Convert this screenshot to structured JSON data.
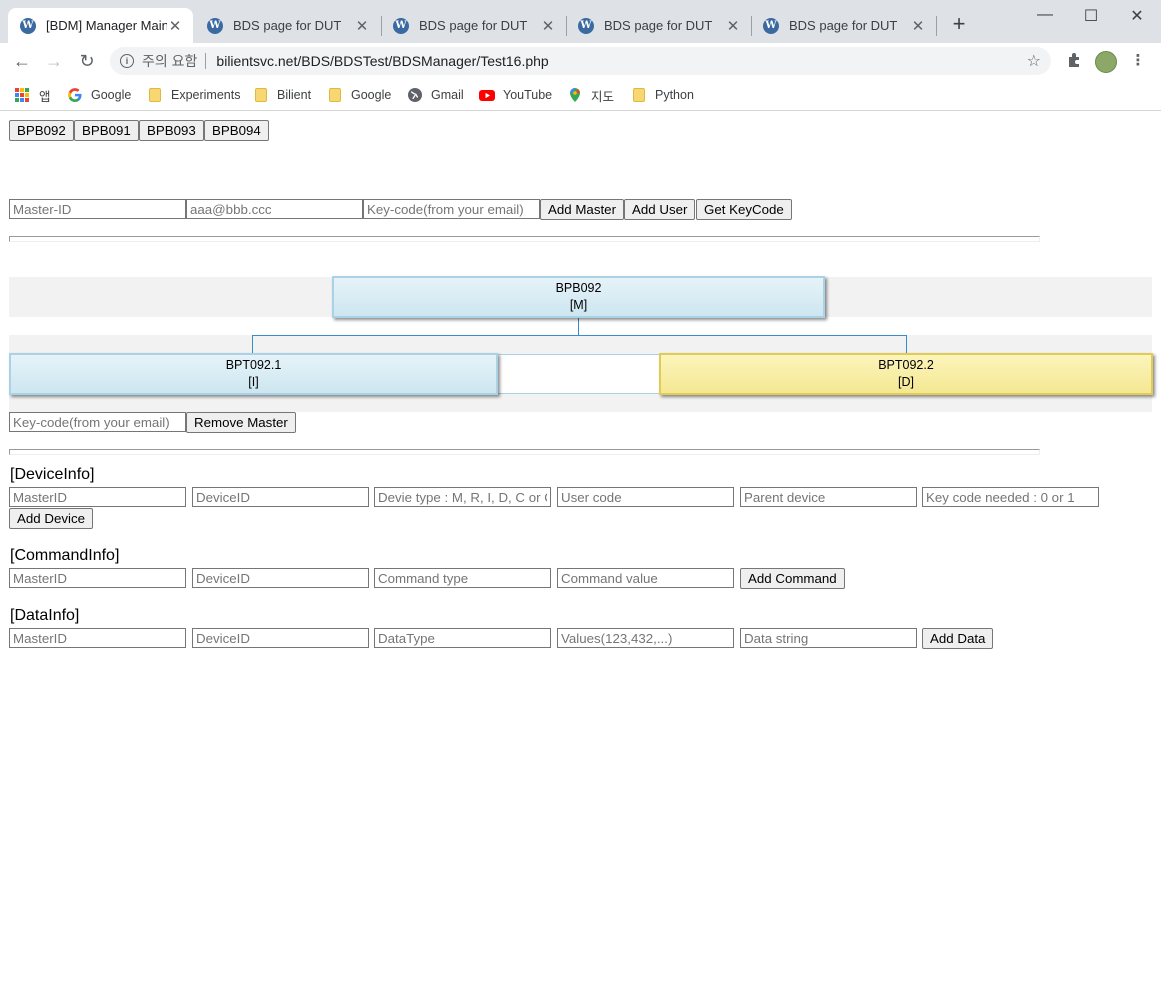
{
  "browser": {
    "tabs": [
      {
        "title": "[BDM] Manager Main",
        "active": true
      },
      {
        "title": "BDS page for DUT",
        "active": false
      },
      {
        "title": "BDS page for DUT",
        "active": false
      },
      {
        "title": "BDS page for DUT",
        "active": false
      },
      {
        "title": "BDS page for DUT",
        "active": false
      }
    ],
    "security_label": "주의 요함",
    "url": "bilientsvc.net/BDS/BDSTest/BDSManager/Test16.php",
    "bookmarks": [
      {
        "label": "앱",
        "icon": "apps-grid-icon"
      },
      {
        "label": "Google",
        "icon": "google-icon"
      },
      {
        "label": "Experiments",
        "icon": "folder-icon"
      },
      {
        "label": "Bilient",
        "icon": "folder-icon"
      },
      {
        "label": "Google",
        "icon": "folder-icon"
      },
      {
        "label": "Gmail",
        "icon": "globe-icon"
      },
      {
        "label": "YouTube",
        "icon": "youtube-icon"
      },
      {
        "label": "지도",
        "icon": "maps-pin-icon"
      },
      {
        "label": "Python",
        "icon": "folder-icon"
      }
    ]
  },
  "device_tabs": [
    "BPB092",
    "BPB091",
    "BPB093",
    "BPB094"
  ],
  "master_form": {
    "master_id_placeholder": "Master-ID",
    "email_placeholder": "aaa@bbb.ccc",
    "keycode_placeholder": "Key-code(from your email)",
    "add_master_label": "Add Master",
    "add_user_label": "Add User",
    "get_keycode_label": "Get KeyCode"
  },
  "tree": {
    "root": {
      "name": "BPB092",
      "type": "[M]",
      "color": "#d9edf5"
    },
    "children": [
      {
        "name": "BPT092.1",
        "type": "[I]",
        "color": "#d9edf5"
      },
      {
        "name": "BPT092.2",
        "type": "[D]",
        "color": "#f8ee9e"
      }
    ]
  },
  "remove_form": {
    "keycode_placeholder": "Key-code(from your email)",
    "remove_master_label": "Remove Master"
  },
  "device_info": {
    "heading": "[DeviceInfo]",
    "placeholders": [
      "MasterID",
      "DeviceID",
      "Devie type : M, R, I, D, C or O",
      "User code",
      "Parent device",
      "Key code needed : 0 or 1"
    ],
    "button_label": "Add Device"
  },
  "command_info": {
    "heading": "[CommandInfo]",
    "placeholders": [
      "MasterID",
      "DeviceID",
      "Command type",
      "Command value"
    ],
    "button_label": "Add Command"
  },
  "data_info": {
    "heading": "[DataInfo]",
    "placeholders": [
      "MasterID",
      "DeviceID",
      "DataType",
      "Values(123,432,...)",
      "Data string"
    ],
    "button_label": "Add Data"
  }
}
